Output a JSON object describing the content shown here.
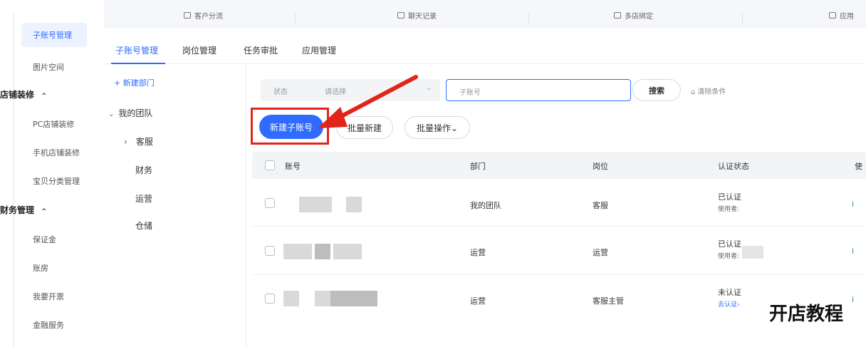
{
  "sidebar": {
    "active_item": "子账号管理",
    "item_image_space": "图片空间",
    "group_shop_decor": "店铺装修",
    "item_pc_decor": "PC店铺装修",
    "item_mobile_decor": "手机店铺装修",
    "item_category_mgmt": "宝贝分类管理",
    "group_finance": "财务管理",
    "item_deposit": "保证金",
    "item_accounts": "账房",
    "item_invoice": "我要开票",
    "item_finance_service": "金融服务",
    "caret": "^"
  },
  "top_strip": {
    "item1": "客户分流",
    "item2": "聊天记录",
    "item3": "多店绑定",
    "item4": "应用"
  },
  "tabs": [
    "子账号管理",
    "岗位管理",
    "任务审批",
    "应用管理"
  ],
  "tree": {
    "add_dept": "+ 新建部门",
    "root": "我的团队",
    "root_toggle": "⌄",
    "child_toggle": "›",
    "children": [
      "客服",
      "财务",
      "运营",
      "仓储"
    ]
  },
  "filter": {
    "status_label": "状态",
    "status_placeholder": "请选择",
    "status_chevron": "⌄",
    "account_placeholder": "子账号",
    "search_label": "搜索",
    "clear_label": "清除条件"
  },
  "actions": {
    "new_account": "新建子账号",
    "batch_new": "批量新建",
    "batch_ops": "批量操作⌄"
  },
  "table": {
    "headers": [
      "账号",
      "部门",
      "岗位",
      "认证状态",
      "使"
    ],
    "rows": [
      {
        "dept": "我的团队",
        "position": "客服",
        "status": "已认证",
        "status_sub": "使用者:",
        "tail": "i"
      },
      {
        "dept": "运营",
        "position": "运营",
        "status": "已认证",
        "status_sub": "使用者:",
        "tail": "i"
      },
      {
        "dept": "运营",
        "position": "客服主管",
        "status": "未认证",
        "status_sub": "去认证›",
        "tail": "i"
      }
    ]
  },
  "watermark": "开店教程",
  "colors": {
    "accent": "#2f6bff",
    "highlight": "#e1251b"
  }
}
